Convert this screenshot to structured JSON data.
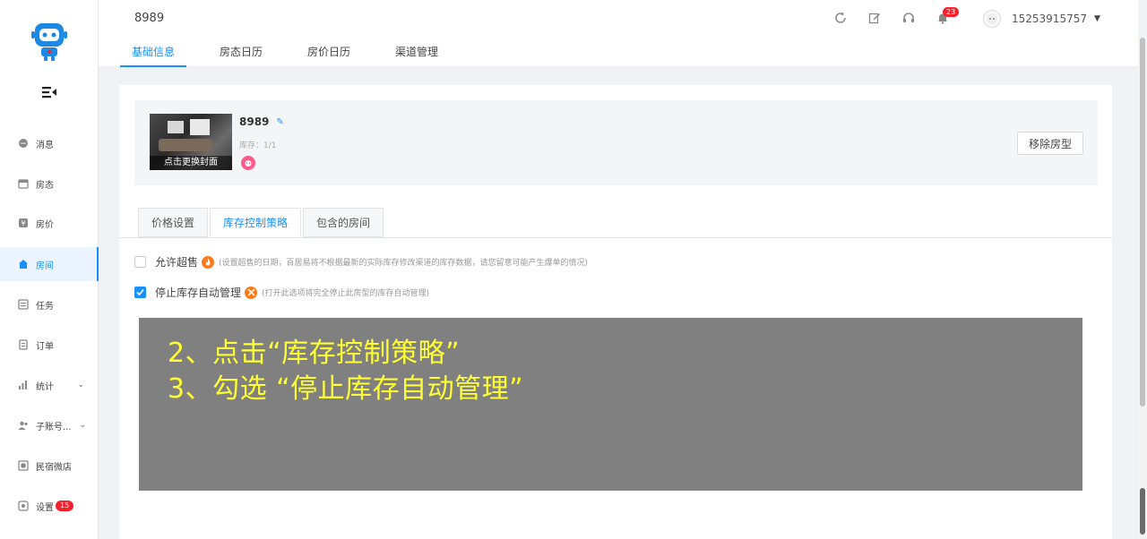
{
  "sidebar": {
    "items": [
      {
        "label": "消息",
        "icon": "message-icon"
      },
      {
        "label": "房态",
        "icon": "calendar-icon"
      },
      {
        "label": "房价",
        "icon": "price-tag-icon"
      },
      {
        "label": "房间",
        "icon": "home-icon"
      },
      {
        "label": "任务",
        "icon": "task-list-icon"
      },
      {
        "label": "订单",
        "icon": "order-icon"
      },
      {
        "label": "统计",
        "icon": "bar-chart-icon"
      },
      {
        "label": "子账号...",
        "icon": "users-icon"
      },
      {
        "label": "民宿微店",
        "icon": "shop-icon"
      },
      {
        "label": "设置",
        "icon": "settings-icon",
        "badge": "15"
      }
    ],
    "active_index": 3
  },
  "header": {
    "title": "8989",
    "tabs": [
      "基础信息",
      "房态日历",
      "房价日历",
      "渠道管理"
    ],
    "notification_count": "23",
    "username": "15253915757"
  },
  "room": {
    "cover_caption": "点击更换封面",
    "name": "8989",
    "stock": "库存：1/1",
    "remove_label": "移除房型"
  },
  "subtabs": [
    "价格设置",
    "库存控制策略",
    "包含的房间"
  ],
  "options": {
    "oversell": {
      "label": "允许超售",
      "hint": "(设置超售的日期，百居易将不根据最新的实际库存修改渠道的库存数据，请您留意可能产生爆单的情况)",
      "checked": false
    },
    "stop_auto": {
      "label": "停止库存自动管理",
      "hint": "(打开此选项将完全停止此房型的库存自动管理)",
      "checked": true
    }
  },
  "overlay": {
    "line1": "2、点击“库存控制策略”",
    "line2": "3、勾选 “停止库存自动管理”"
  },
  "colors": {
    "accent": "#1890ff",
    "badge": "#f5222d",
    "overlay_bg": "#808080",
    "overlay_text": "#ffff33"
  }
}
